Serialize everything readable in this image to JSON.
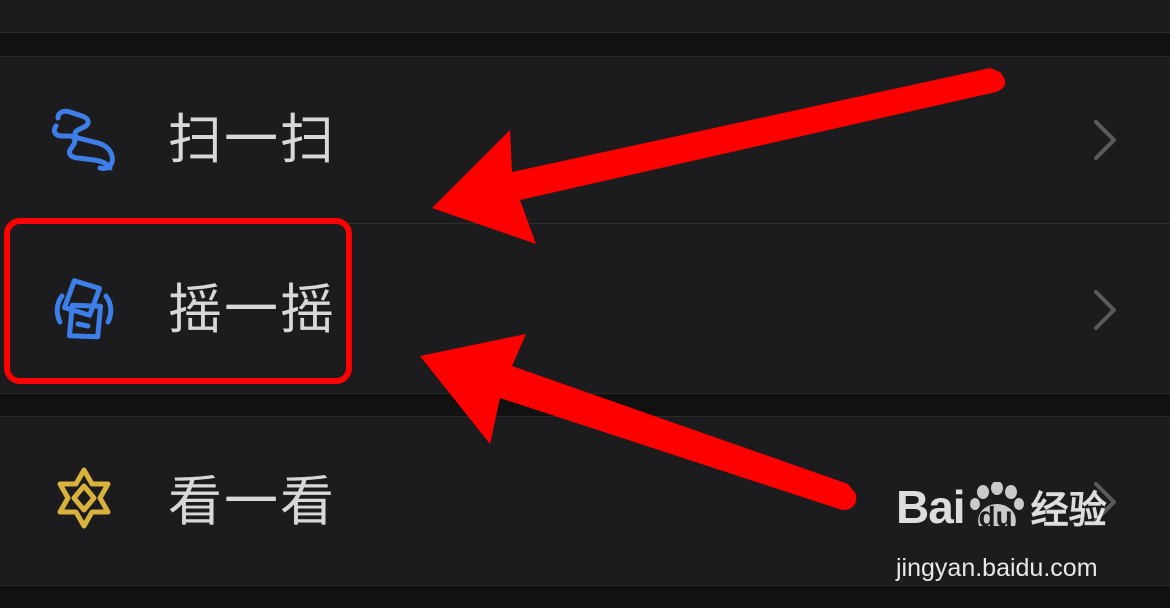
{
  "menu": {
    "items": [
      {
        "label": "扫一扫",
        "icon": "scan-icon"
      },
      {
        "label": "摇一摇",
        "icon": "shake-icon"
      },
      {
        "label": "看一看",
        "icon": "top-stories-icon"
      }
    ]
  },
  "colors": {
    "background": "#111111",
    "row_background": "#1c1c1e",
    "label_text": "#d8d8d8",
    "scan_icon": "#3d7ee8",
    "shake_icon": "#3d7ee8",
    "top_stories_icon": "#d9b23c",
    "annotation": "#ff0000"
  },
  "watermark": {
    "logo_bai": "Bai",
    "logo_du": "du",
    "logo_jingyan": "经验",
    "url": "jingyan.baidu.com"
  }
}
